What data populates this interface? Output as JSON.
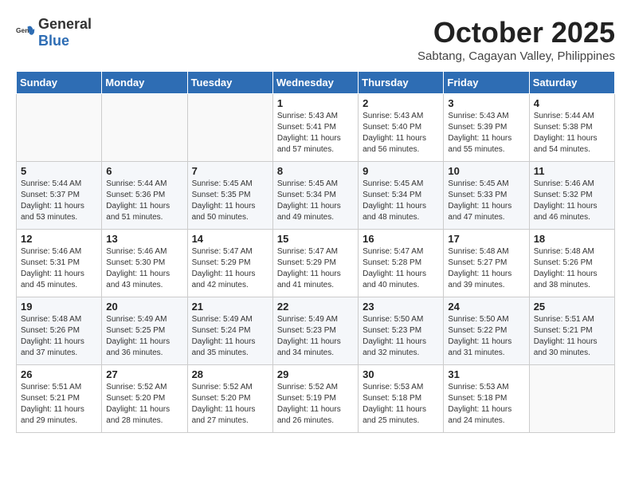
{
  "header": {
    "logo_general": "General",
    "logo_blue": "Blue",
    "month": "October 2025",
    "location": "Sabtang, Cagayan Valley, Philippines"
  },
  "days_of_week": [
    "Sunday",
    "Monday",
    "Tuesday",
    "Wednesday",
    "Thursday",
    "Friday",
    "Saturday"
  ],
  "weeks": [
    [
      {
        "day": "",
        "info": ""
      },
      {
        "day": "",
        "info": ""
      },
      {
        "day": "",
        "info": ""
      },
      {
        "day": "1",
        "info": "Sunrise: 5:43 AM\nSunset: 5:41 PM\nDaylight: 11 hours and 57 minutes."
      },
      {
        "day": "2",
        "info": "Sunrise: 5:43 AM\nSunset: 5:40 PM\nDaylight: 11 hours and 56 minutes."
      },
      {
        "day": "3",
        "info": "Sunrise: 5:43 AM\nSunset: 5:39 PM\nDaylight: 11 hours and 55 minutes."
      },
      {
        "day": "4",
        "info": "Sunrise: 5:44 AM\nSunset: 5:38 PM\nDaylight: 11 hours and 54 minutes."
      }
    ],
    [
      {
        "day": "5",
        "info": "Sunrise: 5:44 AM\nSunset: 5:37 PM\nDaylight: 11 hours and 53 minutes."
      },
      {
        "day": "6",
        "info": "Sunrise: 5:44 AM\nSunset: 5:36 PM\nDaylight: 11 hours and 51 minutes."
      },
      {
        "day": "7",
        "info": "Sunrise: 5:45 AM\nSunset: 5:35 PM\nDaylight: 11 hours and 50 minutes."
      },
      {
        "day": "8",
        "info": "Sunrise: 5:45 AM\nSunset: 5:34 PM\nDaylight: 11 hours and 49 minutes."
      },
      {
        "day": "9",
        "info": "Sunrise: 5:45 AM\nSunset: 5:34 PM\nDaylight: 11 hours and 48 minutes."
      },
      {
        "day": "10",
        "info": "Sunrise: 5:45 AM\nSunset: 5:33 PM\nDaylight: 11 hours and 47 minutes."
      },
      {
        "day": "11",
        "info": "Sunrise: 5:46 AM\nSunset: 5:32 PM\nDaylight: 11 hours and 46 minutes."
      }
    ],
    [
      {
        "day": "12",
        "info": "Sunrise: 5:46 AM\nSunset: 5:31 PM\nDaylight: 11 hours and 45 minutes."
      },
      {
        "day": "13",
        "info": "Sunrise: 5:46 AM\nSunset: 5:30 PM\nDaylight: 11 hours and 43 minutes."
      },
      {
        "day": "14",
        "info": "Sunrise: 5:47 AM\nSunset: 5:29 PM\nDaylight: 11 hours and 42 minutes."
      },
      {
        "day": "15",
        "info": "Sunrise: 5:47 AM\nSunset: 5:29 PM\nDaylight: 11 hours and 41 minutes."
      },
      {
        "day": "16",
        "info": "Sunrise: 5:47 AM\nSunset: 5:28 PM\nDaylight: 11 hours and 40 minutes."
      },
      {
        "day": "17",
        "info": "Sunrise: 5:48 AM\nSunset: 5:27 PM\nDaylight: 11 hours and 39 minutes."
      },
      {
        "day": "18",
        "info": "Sunrise: 5:48 AM\nSunset: 5:26 PM\nDaylight: 11 hours and 38 minutes."
      }
    ],
    [
      {
        "day": "19",
        "info": "Sunrise: 5:48 AM\nSunset: 5:26 PM\nDaylight: 11 hours and 37 minutes."
      },
      {
        "day": "20",
        "info": "Sunrise: 5:49 AM\nSunset: 5:25 PM\nDaylight: 11 hours and 36 minutes."
      },
      {
        "day": "21",
        "info": "Sunrise: 5:49 AM\nSunset: 5:24 PM\nDaylight: 11 hours and 35 minutes."
      },
      {
        "day": "22",
        "info": "Sunrise: 5:49 AM\nSunset: 5:23 PM\nDaylight: 11 hours and 34 minutes."
      },
      {
        "day": "23",
        "info": "Sunrise: 5:50 AM\nSunset: 5:23 PM\nDaylight: 11 hours and 32 minutes."
      },
      {
        "day": "24",
        "info": "Sunrise: 5:50 AM\nSunset: 5:22 PM\nDaylight: 11 hours and 31 minutes."
      },
      {
        "day": "25",
        "info": "Sunrise: 5:51 AM\nSunset: 5:21 PM\nDaylight: 11 hours and 30 minutes."
      }
    ],
    [
      {
        "day": "26",
        "info": "Sunrise: 5:51 AM\nSunset: 5:21 PM\nDaylight: 11 hours and 29 minutes."
      },
      {
        "day": "27",
        "info": "Sunrise: 5:52 AM\nSunset: 5:20 PM\nDaylight: 11 hours and 28 minutes."
      },
      {
        "day": "28",
        "info": "Sunrise: 5:52 AM\nSunset: 5:20 PM\nDaylight: 11 hours and 27 minutes."
      },
      {
        "day": "29",
        "info": "Sunrise: 5:52 AM\nSunset: 5:19 PM\nDaylight: 11 hours and 26 minutes."
      },
      {
        "day": "30",
        "info": "Sunrise: 5:53 AM\nSunset: 5:18 PM\nDaylight: 11 hours and 25 minutes."
      },
      {
        "day": "31",
        "info": "Sunrise: 5:53 AM\nSunset: 5:18 PM\nDaylight: 11 hours and 24 minutes."
      },
      {
        "day": "",
        "info": ""
      }
    ]
  ]
}
